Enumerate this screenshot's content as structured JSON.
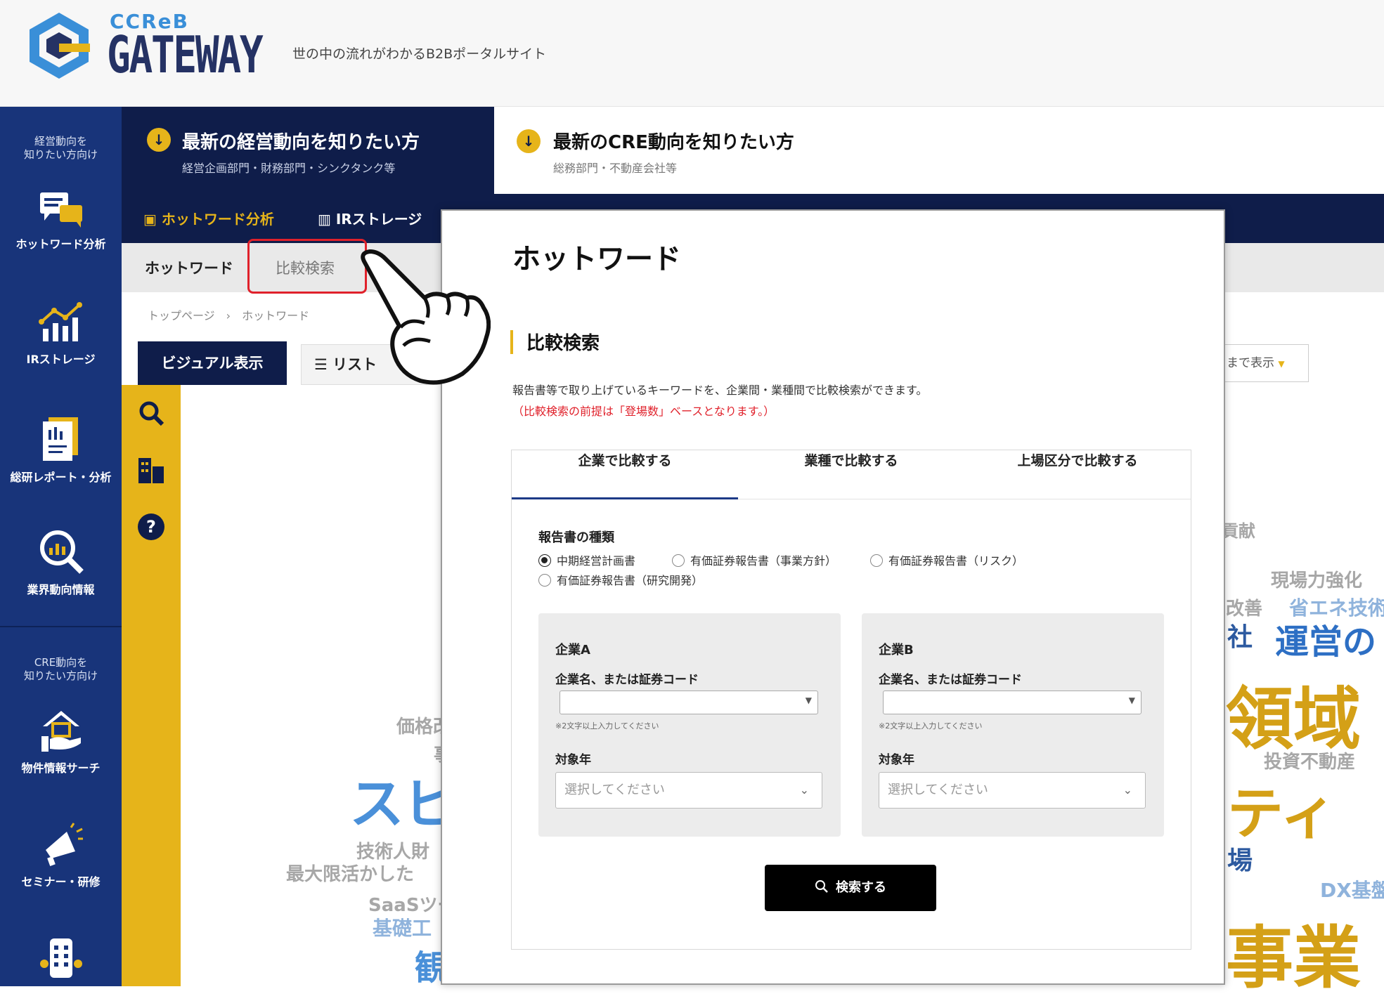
{
  "header": {
    "brand_small": "CCReB",
    "brand_main": "GATEWAY",
    "tagline": "世の中の流れがわかるB2Bポータルサイト"
  },
  "sidebar": {
    "caption_top": [
      "経営動向を",
      "知りたい方向け"
    ],
    "caption_cre": [
      "CRE動向を",
      "知りたい方向け"
    ],
    "items": [
      {
        "label": "ホットワード分析",
        "icon": "chat-bubbles-icon"
      },
      {
        "label": "IRストレージ",
        "icon": "growth-chart-icon"
      },
      {
        "label": "総研レポート・分析",
        "icon": "report-icon"
      },
      {
        "label": "業界動向情報",
        "icon": "magnifier-chart-icon"
      },
      {
        "label": "物件情報サーチ",
        "icon": "house-hand-icon"
      },
      {
        "label": "セミナー・研修",
        "icon": "megaphone-icon"
      },
      {
        "label": "",
        "icon": "building-icon"
      }
    ]
  },
  "audience": {
    "left_title": "最新の経営動向を知りたい方",
    "left_sub": "経営企画部門・財務部門・シンクタンク等",
    "right_title": "最新のCRE動向を知りたい方",
    "right_sub": "総務部門・不動産会社等"
  },
  "nav": {
    "hotword_analysis": "ホットワード分析",
    "ir_storage": "IRストレージ"
  },
  "subtabs": {
    "hotword": "ホットワード",
    "compare": "比較検索"
  },
  "breadcrumb": "トップページ　›　ホットワード",
  "view_tabs": {
    "visual": "ビジュアル表示",
    "list": "リスト"
  },
  "display_select": "まで表示",
  "wordcloud": [
    {
      "text": "価格改",
      "color": "#a7a7a7"
    },
    {
      "text": "事",
      "color": "#a7a7a7"
    },
    {
      "text": "スピ",
      "color": "#4a90d9"
    },
    {
      "text": "技術人財",
      "color": "#a7a7a7"
    },
    {
      "text": "最大限活かした",
      "color": "#a7a7a7"
    },
    {
      "text": "SaaSツー",
      "color": "#a7a7a7"
    },
    {
      "text": "基礎工",
      "color": "#8fb3dc"
    },
    {
      "text": "観",
      "color": "#4a90d9"
    },
    {
      "text": "貢献",
      "color": "#a7a7a7"
    },
    {
      "text": "現場力強化",
      "color": "#a7a7a7"
    },
    {
      "text": "改善",
      "color": "#a7a7a7"
    },
    {
      "text": "省エネ技術",
      "color": "#8fb3dc"
    },
    {
      "text": "社",
      "color": "#2d5aa0"
    },
    {
      "text": "運営の",
      "color": "#2d6fc4"
    },
    {
      "text": "領域",
      "color": "#d4a017"
    },
    {
      "text": "投資不動産",
      "color": "#a7a7a7"
    },
    {
      "text": "ティ",
      "color": "#d4a017"
    },
    {
      "text": "場",
      "color": "#2d5aa0"
    },
    {
      "text": "DX基盤",
      "color": "#8fb3dc"
    },
    {
      "text": "事業",
      "color": "#d4a017"
    }
  ],
  "modal": {
    "title": "ホットワード",
    "section_title": "比較検索",
    "description": "報告書等で取り上げているキーワードを、企業間・業種間で比較検索ができます。",
    "note": "（比較検索の前提は「登場数」ベースとなります。）",
    "tabs": [
      "企業で比較する",
      "業種で比較する",
      "上場区分で比較する"
    ],
    "report_type_label": "報告書の種類",
    "report_types": [
      {
        "label": "中期経営計画書",
        "selected": true
      },
      {
        "label": "有価証券報告書（事業方針）",
        "selected": false
      },
      {
        "label": "有価証券報告書（リスク）",
        "selected": false
      },
      {
        "label": "有価証券報告書（研究開発）",
        "selected": false
      }
    ],
    "company_a": {
      "heading": "企業A",
      "field_label": "企業名、または証券コード",
      "hint": "※2文字以上入力してください",
      "year_label": "対象年",
      "year_placeholder": "選択してください"
    },
    "company_b": {
      "heading": "企業B",
      "field_label": "企業名、または証券コード",
      "hint": "※2文字以上入力してください",
      "year_label": "対象年",
      "year_placeholder": "選択してください"
    },
    "search_button": "検索する"
  },
  "colors": {
    "navy": "#0f1d4a",
    "sidebar_blue": "#18347a",
    "accent_yellow": "#e6b41a",
    "highlight_red": "#e0212b"
  }
}
